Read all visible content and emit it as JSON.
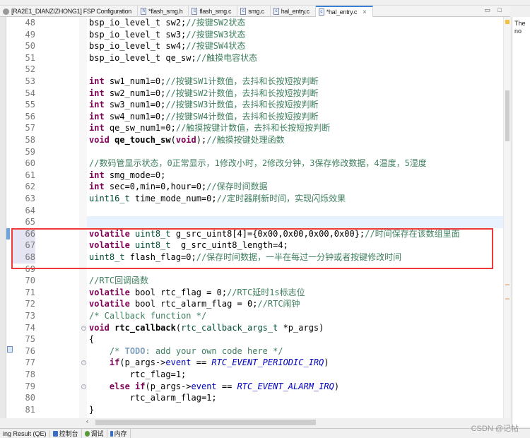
{
  "tabs": [
    {
      "label": "[RA2E1_DIANZIZHONG1] FSP Configuration",
      "icon": "gear-icon"
    },
    {
      "label": "*flash_smg.h",
      "icon": "h-file-icon"
    },
    {
      "label": "flash_smg.c",
      "icon": "c-file-icon"
    },
    {
      "label": "smg.c",
      "icon": "c-file-icon"
    },
    {
      "label": "hal_entry.c",
      "icon": "c-file-icon"
    },
    {
      "label": "*hal_entry.c",
      "icon": "c-file-icon",
      "active": true,
      "close": "×"
    }
  ],
  "window_buttons": "▭ □",
  "right_panel": {
    "line1": "The",
    "line2": "no"
  },
  "bottom_tabs": [
    {
      "label": "ing Result (QE)"
    },
    {
      "label": "控制台",
      "color": "#3a6fc4"
    },
    {
      "label": "调试",
      "color": "#5a9a3a"
    },
    {
      "label": "内存",
      "color": "#3a6fc4"
    }
  ],
  "watermark": "CSDN @记帖",
  "highlight_color": "#f03a3a",
  "current_line": 65,
  "highlighted_lines": [
    66,
    67,
    68
  ],
  "fold_lines": [
    74,
    77,
    79
  ],
  "code": [
    {
      "n": "48",
      "s": [
        [
          "",
          "bsp_io_level_t sw2;"
        ],
        [
          "c",
          "//按键SW2状态"
        ]
      ]
    },
    {
      "n": "49",
      "s": [
        [
          "",
          "bsp_io_level_t sw3;"
        ],
        [
          "c",
          "//按键SW3状态"
        ]
      ]
    },
    {
      "n": "50",
      "s": [
        [
          "",
          "bsp_io_level_t sw4;"
        ],
        [
          "c",
          "//按键SW4状态"
        ]
      ]
    },
    {
      "n": "51",
      "s": [
        [
          "",
          "bsp_io_level_t qe_sw;"
        ],
        [
          "c",
          "//触摸电容状态"
        ]
      ]
    },
    {
      "n": "52",
      "s": []
    },
    {
      "n": "53",
      "s": [
        [
          "k",
          "int"
        ],
        [
          "",
          " sw1_num1=0;"
        ],
        [
          "c",
          "//按键SW1计数值，去抖和长按短按判断"
        ]
      ]
    },
    {
      "n": "54",
      "s": [
        [
          "k",
          "int"
        ],
        [
          "",
          " sw2_num1=0;"
        ],
        [
          "c",
          "//按键SW2计数值，去抖和长按短按判断"
        ]
      ]
    },
    {
      "n": "55",
      "s": [
        [
          "k",
          "int"
        ],
        [
          "",
          " sw3_num1=0;"
        ],
        [
          "c",
          "//按键SW3计数值，去抖和长按短按判断"
        ]
      ]
    },
    {
      "n": "56",
      "s": [
        [
          "k",
          "int"
        ],
        [
          "",
          " sw4_num1=0;"
        ],
        [
          "c",
          "//按键SW4计数值，去抖和长按短按判断"
        ]
      ]
    },
    {
      "n": "57",
      "s": [
        [
          "k",
          "int"
        ],
        [
          "",
          " qe_sw_num1=0;"
        ],
        [
          "c",
          "//触摸按键计数值，去抖和长按短按判断"
        ]
      ]
    },
    {
      "n": "58",
      "s": [
        [
          "k",
          "void"
        ],
        [
          "",
          " "
        ],
        [
          "f",
          "qe_touch_sw"
        ],
        [
          "",
          "("
        ],
        [
          "k",
          "void"
        ],
        [
          "",
          ");"
        ],
        [
          "c",
          "//触摸按键处理函数"
        ]
      ]
    },
    {
      "n": "59",
      "s": []
    },
    {
      "n": "60",
      "s": [
        [
          "c",
          "//数码管显示状态，0正常显示，1修改小时，2修改分钟，3保存修改数据，4温度，5湿度"
        ]
      ]
    },
    {
      "n": "61",
      "s": [
        [
          "k",
          "int"
        ],
        [
          "",
          " smg_mode=0;"
        ]
      ]
    },
    {
      "n": "62",
      "s": [
        [
          "k",
          "int"
        ],
        [
          "",
          " sec=0,min=0,hour=0;"
        ],
        [
          "c",
          "//保存时间数据"
        ]
      ]
    },
    {
      "n": "63",
      "s": [
        [
          "t",
          "uint16_t"
        ],
        [
          "",
          " time_mode_num=0;"
        ],
        [
          "c",
          "//定时器刷新时间，实现闪烁效果"
        ]
      ]
    },
    {
      "n": "64",
      "s": []
    },
    {
      "n": "65",
      "s": []
    },
    {
      "n": "66",
      "s": [
        [
          "k",
          "volatile"
        ],
        [
          "",
          " "
        ],
        [
          "t",
          "uint8_t"
        ],
        [
          "",
          " g_src_uint8[4]={0x00,0x00,0x00,0x00};"
        ],
        [
          "c",
          "//时间保存在该数组里面"
        ]
      ]
    },
    {
      "n": "67",
      "s": [
        [
          "k",
          "volatile"
        ],
        [
          "",
          " "
        ],
        [
          "t",
          "uint8_t"
        ],
        [
          "",
          "  g_src_uint8_length=4;"
        ]
      ]
    },
    {
      "n": "68",
      "s": [
        [
          "t",
          "uint8_t"
        ],
        [
          "",
          " flash_flag=0;"
        ],
        [
          "c",
          "//保存时间数据，一半在每过一分钟或者按键修改时间"
        ]
      ]
    },
    {
      "n": "69",
      "s": []
    },
    {
      "n": "70",
      "s": [
        [
          "c",
          "//RTC回调函数"
        ]
      ]
    },
    {
      "n": "71",
      "s": [
        [
          "k",
          "volatile"
        ],
        [
          "",
          " bool rtc_flag = 0;"
        ],
        [
          "c",
          "//RTC延时1s标志位"
        ]
      ]
    },
    {
      "n": "72",
      "s": [
        [
          "k",
          "volatile"
        ],
        [
          "",
          " bool rtc_alarm_flag = 0;"
        ],
        [
          "c",
          "//RTC闹钟"
        ]
      ]
    },
    {
      "n": "73",
      "s": [
        [
          "c",
          "/* Callback function */"
        ]
      ]
    },
    {
      "n": "74",
      "s": [
        [
          "k",
          "void"
        ],
        [
          "",
          " "
        ],
        [
          "f",
          "rtc_callback"
        ],
        [
          "",
          "("
        ],
        [
          "t",
          "rtc_callback_args_t"
        ],
        [
          "",
          " *p_args)"
        ]
      ]
    },
    {
      "n": "75",
      "s": [
        [
          "",
          "{"
        ]
      ]
    },
    {
      "n": "76",
      "s": [
        [
          "",
          "    "
        ],
        [
          "c",
          "/* "
        ],
        [
          "d",
          "TODO"
        ],
        [
          "c",
          ": add your own code here */"
        ]
      ]
    },
    {
      "n": "77",
      "s": [
        [
          "",
          "    "
        ],
        [
          "k",
          "if"
        ],
        [
          "",
          "(p_args->"
        ],
        [
          "e",
          "event"
        ],
        [
          "",
          " == "
        ],
        [
          "i",
          "RTC_EVENT_PERIODIC_IRQ"
        ],
        [
          "",
          ")"
        ]
      ]
    },
    {
      "n": "78",
      "s": [
        [
          "",
          "        rtc_flag=1;"
        ]
      ]
    },
    {
      "n": "79",
      "s": [
        [
          "",
          "    "
        ],
        [
          "k",
          "else"
        ],
        [
          "",
          " "
        ],
        [
          "k",
          "if"
        ],
        [
          "",
          "(p_args->"
        ],
        [
          "e",
          "event"
        ],
        [
          "",
          " == "
        ],
        [
          "i",
          "RTC_EVENT_ALARM_IRQ"
        ],
        [
          "",
          ")"
        ]
      ]
    },
    {
      "n": "80",
      "s": [
        [
          "",
          "        rtc_alarm_flag=1;"
        ]
      ]
    },
    {
      "n": "81",
      "s": [
        [
          "",
          "}"
        ]
      ]
    }
  ]
}
